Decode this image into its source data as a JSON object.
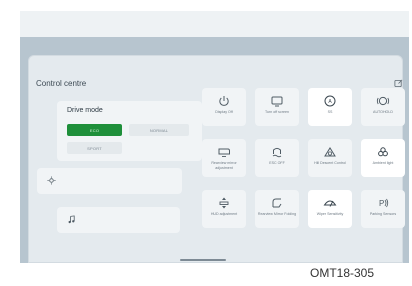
{
  "panel": {
    "title": "Control centre",
    "edit_icon": "edit-icon"
  },
  "drive_mode": {
    "label": "Drive mode",
    "options": [
      {
        "label": "ECO",
        "selected": true
      },
      {
        "label": "NORMAL",
        "selected": false
      },
      {
        "label": "SPORT",
        "selected": false
      }
    ]
  },
  "sliders": [
    {
      "icon": "brightness-icon"
    },
    {
      "icon": "music-note-icon"
    }
  ],
  "tiles": [
    {
      "label": "Display Off",
      "icon": "power-icon",
      "active": false
    },
    {
      "label": "Turn off screen",
      "icon": "screen-off-icon",
      "active": false
    },
    {
      "label": "SS",
      "icon": "auto-start-stop-icon",
      "active": true
    },
    {
      "label": "AUTOHOLD",
      "icon": "autohold-icon",
      "active": false
    },
    {
      "label": "Rearview mirror adjustment",
      "icon": "mirror-adjust-icon",
      "active": false
    },
    {
      "label": "ESC OFF",
      "icon": "esc-off-icon",
      "active": false
    },
    {
      "label": "Hill Descent Control",
      "icon": "hill-descent-icon",
      "active": false
    },
    {
      "label": "Ambient light",
      "icon": "ambient-light-icon",
      "active": true
    },
    {
      "label": "HUD adjustment",
      "icon": "hud-icon",
      "active": false
    },
    {
      "label": "Rearview Mirror Folding",
      "icon": "mirror-fold-icon",
      "active": false
    },
    {
      "label": "Wiper Sensitivity",
      "icon": "wiper-icon",
      "active": true
    },
    {
      "label": "Parking Sensors",
      "icon": "parking-sensor-icon",
      "active": false
    }
  ],
  "caption": "OMT18-305",
  "colors": {
    "eco_selected": "#1e8f3a",
    "screen_bg": "#b7c5cf",
    "panel_bg": "#e4eaee",
    "tile_bg": "#f1f4f6"
  }
}
